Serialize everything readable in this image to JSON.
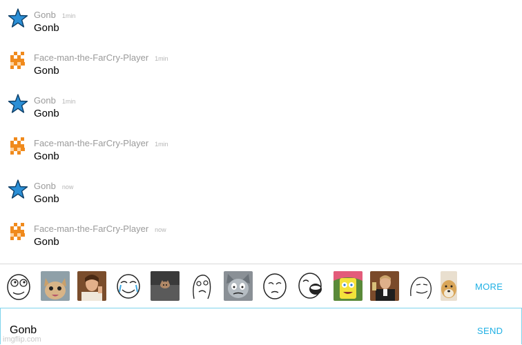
{
  "messages": [
    {
      "user": "Gonb",
      "time": "1min",
      "text": "Gonb",
      "avatar": "star-icon"
    },
    {
      "user": "Face-man-the-FarCry-Player",
      "time": "1min",
      "text": "Gonb",
      "avatar": "pixel-invader-icon"
    },
    {
      "user": "Gonb",
      "time": "1min",
      "text": "Gonb",
      "avatar": "star-icon"
    },
    {
      "user": "Face-man-the-FarCry-Player",
      "time": "1min",
      "text": "Gonb",
      "avatar": "pixel-invader-icon"
    },
    {
      "user": "Gonb",
      "time": "now",
      "text": "Gonb",
      "avatar": "star-icon"
    },
    {
      "user": "Face-man-the-FarCry-Player",
      "time": "now",
      "text": "Gonb",
      "avatar": "pixel-invader-icon"
    }
  ],
  "stickers": [
    "rage-face-sticker",
    "cat-sticker",
    "thumbs-up-man-sticker",
    "crying-face-sticker",
    "ceiling-cat-sticker",
    "derp-face-sticker",
    "tom-cat-sticker",
    "okay-face-sticker",
    "lol-face-sticker",
    "spongebob-sticker",
    "cheers-man-sticker",
    "meme-face-sticker",
    "doge-sticker"
  ],
  "sticker_bar": {
    "more_label": "MORE"
  },
  "input": {
    "value": "Gonb",
    "send_label": "SEND"
  },
  "watermark": "imgflip.com",
  "colors": {
    "accent": "#1fb0e4",
    "star": "#2b8fd6",
    "invader": "#f08a1c"
  }
}
